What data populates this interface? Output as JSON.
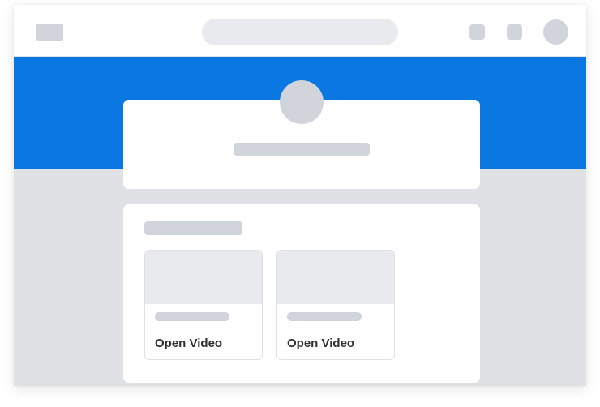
{
  "videos": {
    "items": [
      {
        "link_label": "Open Video"
      },
      {
        "link_label": "Open Video"
      }
    ]
  },
  "colors": {
    "hero": "#0a77e2",
    "page_background": "#dfe1e5",
    "placeholder": "#d1d5db",
    "card": "#ffffff"
  },
  "icons": {
    "logo": "logo-icon",
    "top_right_1": "square-icon",
    "top_right_2": "square-icon",
    "profile": "avatar-icon"
  }
}
